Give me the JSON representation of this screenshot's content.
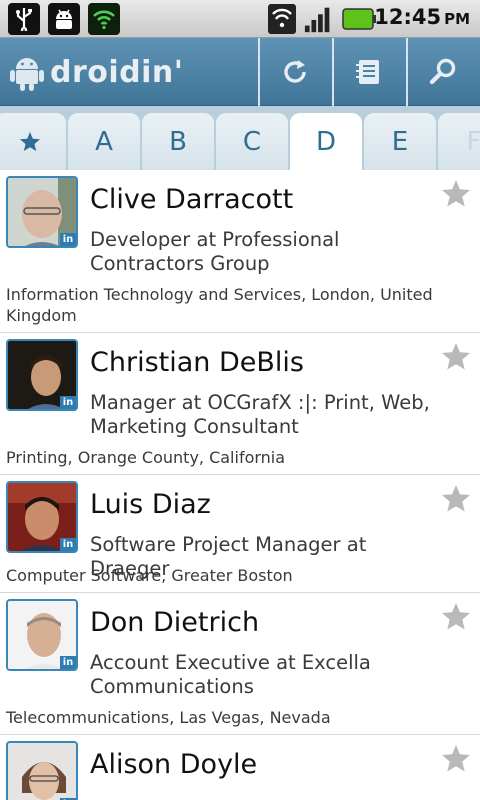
{
  "status_bar": {
    "icons": [
      "usb-icon",
      "android-debug-icon",
      "wifi-shield-icon",
      "wifi-signal-icon",
      "cell-signal-icon",
      "battery-icon"
    ],
    "time": "12:45",
    "ampm": "PM",
    "battery_color": "#5fc21b"
  },
  "app_bar": {
    "logo_text": "droidin'",
    "actions": [
      "refresh-icon",
      "compose-icon",
      "search-icon"
    ],
    "bg_color": "#4a82a7"
  },
  "tabs": [
    {
      "label": "★",
      "icon": "favorites-star-icon"
    },
    {
      "label": "A"
    },
    {
      "label": "B"
    },
    {
      "label": "C"
    },
    {
      "label": "D",
      "active": true
    },
    {
      "label": "E"
    },
    {
      "label": "F"
    }
  ],
  "contacts": [
    {
      "name": "Clive Darracott",
      "headline": "Developer at Professional Contractors Group",
      "meta": "Information Technology and Services, London, United Kingdom",
      "network_badge": "in",
      "favorite": false
    },
    {
      "name": "Christian DeBlis",
      "headline": "Manager at OCGrafX :|: Print, Web, Marketing Consultant",
      "meta": "Printing, Orange County, California",
      "network_badge": "in",
      "favorite": false
    },
    {
      "name": "Luis Diaz",
      "headline": "Software Project Manager at Draeger",
      "meta": "Computer Software, Greater Boston",
      "network_badge": "in",
      "favorite": false
    },
    {
      "name": "Don Dietrich",
      "headline": "Account Executive at Excella Communications",
      "meta": "Telecommunications, Las Vegas, Nevada",
      "network_badge": "in",
      "favorite": false
    },
    {
      "name": "Alison Doyle",
      "headline": "",
      "meta": "",
      "network_badge": "in",
      "favorite": false
    }
  ]
}
